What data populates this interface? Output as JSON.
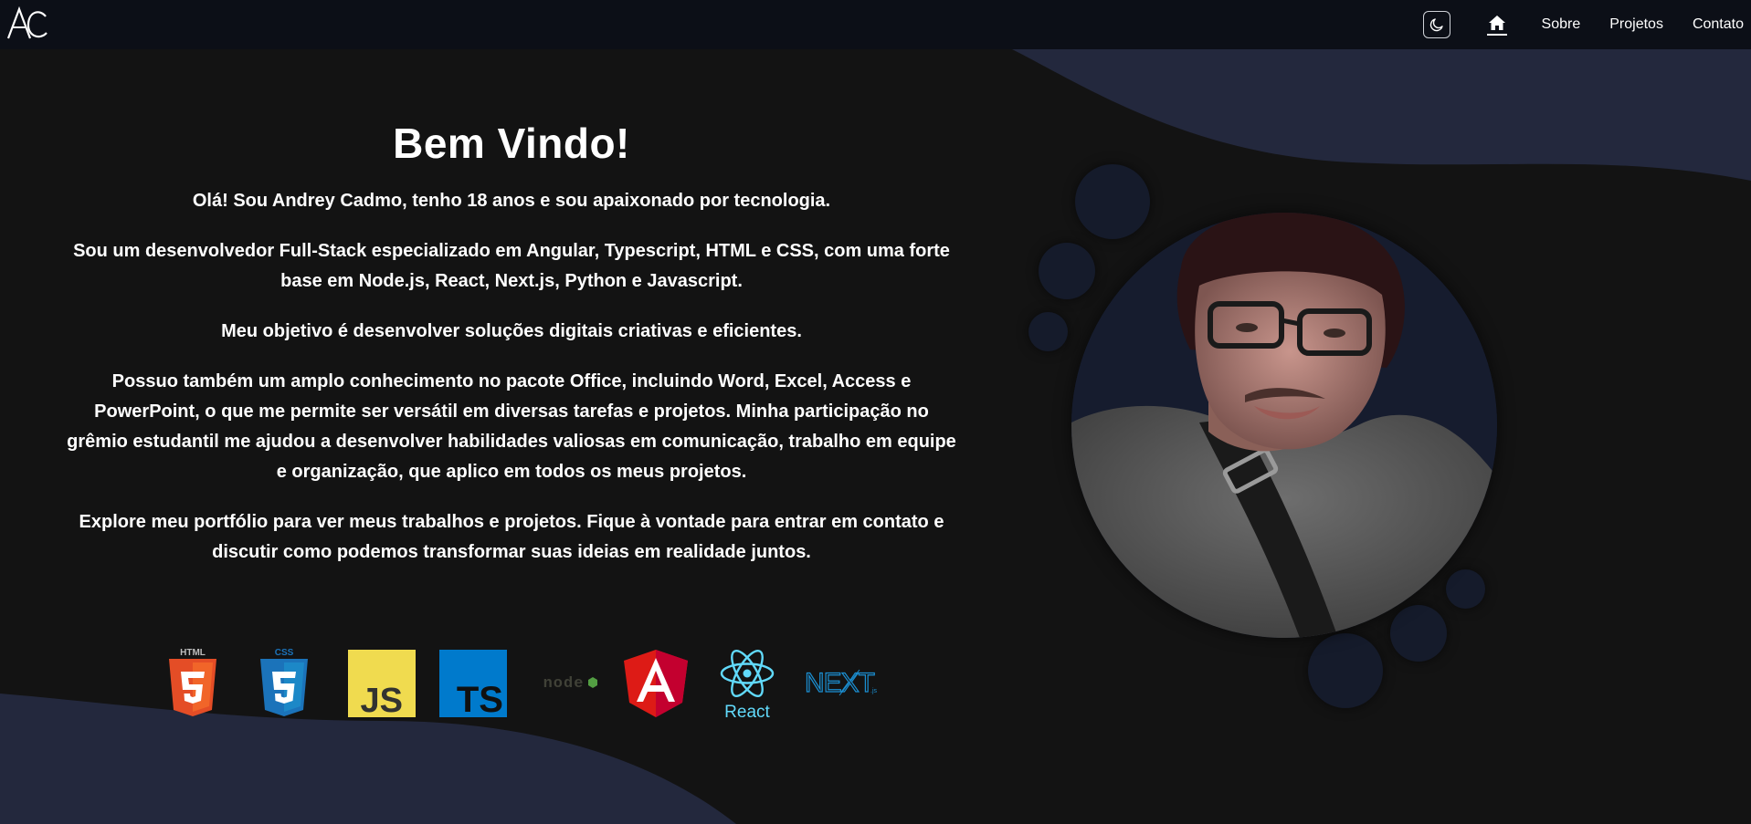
{
  "nav": {
    "logo_text": "AC",
    "theme_toggle_icon": "moon-icon",
    "home_icon": "home-icon",
    "links": [
      {
        "label": "Sobre"
      },
      {
        "label": "Projetos"
      },
      {
        "label": "Contato"
      }
    ]
  },
  "intro": {
    "title": "Bem Vindo!",
    "paragraphs": [
      "Olá! Sou Andrey Cadmo, tenho 18 anos e sou apaixonado por tecnologia.",
      "Sou um desenvolvedor Full-Stack especializado em Angular, Typescript, HTML e CSS, com uma forte base em Node.js, React, Next.js, Python e Javascript.",
      "Meu objetivo é desenvolver soluções digitais criativas e eficientes.",
      "Possuo também um amplo conhecimento no pacote Office, incluindo Word, Excel, Access e PowerPoint, o que me permite ser versátil em diversas tarefas e projetos. Minha participação no grêmio estudantil me ajudou a desenvolver habilidades valiosas em comunicação, trabalho em equipe e organização, que aplico em todos os meus projetos.",
      "Explore meu portfólio para ver meus trabalhos e projetos. Fique à vontade para entrar em contato e discutir como podemos transformar suas ideias em realidade juntos."
    ]
  },
  "tech_icons": {
    "html": {
      "name": "html5-icon",
      "label": "HTML",
      "color": "#e44d26"
    },
    "css": {
      "name": "css3-icon",
      "label": "CSS",
      "color": "#1b73ba"
    },
    "js": {
      "name": "javascript-icon",
      "label": "JS",
      "color": "#f0db4f"
    },
    "ts": {
      "name": "typescript-icon",
      "label": "TS",
      "color": "#007acc"
    },
    "node": {
      "name": "nodejs-icon",
      "label": "node",
      "color": "#539e43"
    },
    "angular": {
      "name": "angular-icon",
      "label": "A",
      "color": "#dd1b16"
    },
    "react": {
      "name": "react-icon",
      "label": "React",
      "color": "#61dafb"
    },
    "next": {
      "name": "nextjs-icon",
      "label": "NEXT",
      "sublabel": ".js",
      "color": "#1b8fd2"
    }
  },
  "colors": {
    "background": "#131313",
    "navbar": "#0c0f17",
    "wave": "#23283d",
    "bubble": "#151b2b"
  }
}
